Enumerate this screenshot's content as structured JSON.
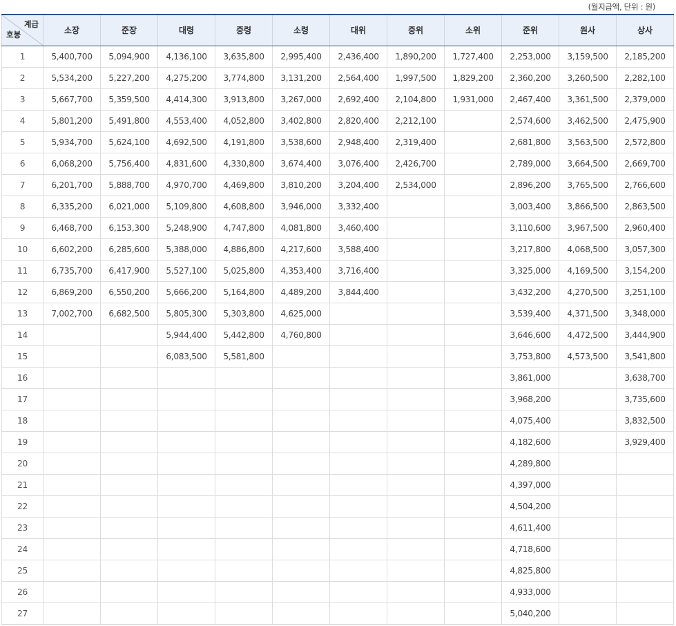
{
  "note": "(월지급액, 단위 : 원)",
  "corner": {
    "top": "계급",
    "bottom": "호봉"
  },
  "headers": [
    "소장",
    "준장",
    "대령",
    "중령",
    "소령",
    "대위",
    "중위",
    "소위",
    "준위",
    "원사",
    "상사"
  ],
  "rows": [
    [
      "1",
      "5,400,700",
      "5,094,900",
      "4,136,100",
      "3,635,800",
      "2,995,400",
      "2,436,400",
      "1,890,200",
      "1,727,400",
      "2,253,000",
      "3,159,500",
      "2,185,200"
    ],
    [
      "2",
      "5,534,200",
      "5,227,200",
      "4,275,200",
      "3,774,800",
      "3,131,200",
      "2,564,400",
      "1,997,500",
      "1,829,200",
      "2,360,200",
      "3,260,500",
      "2,282,100"
    ],
    [
      "3",
      "5,667,700",
      "5,359,500",
      "4,414,300",
      "3,913,800",
      "3,267,000",
      "2,692,400",
      "2,104,800",
      "1,931,000",
      "2,467,400",
      "3,361,500",
      "2,379,000"
    ],
    [
      "4",
      "5,801,200",
      "5,491,800",
      "4,553,400",
      "4,052,800",
      "3,402,800",
      "2,820,400",
      "2,212,100",
      "",
      "2,574,600",
      "3,462,500",
      "2,475,900"
    ],
    [
      "5",
      "5,934,700",
      "5,624,100",
      "4,692,500",
      "4,191,800",
      "3,538,600",
      "2,948,400",
      "2,319,400",
      "",
      "2,681,800",
      "3,563,500",
      "2,572,800"
    ],
    [
      "6",
      "6,068,200",
      "5,756,400",
      "4,831,600",
      "4,330,800",
      "3,674,400",
      "3,076,400",
      "2,426,700",
      "",
      "2,789,000",
      "3,664,500",
      "2,669,700"
    ],
    [
      "7",
      "6,201,700",
      "5,888,700",
      "4,970,700",
      "4,469,800",
      "3,810,200",
      "3,204,400",
      "2,534,000",
      "",
      "2,896,200",
      "3,765,500",
      "2,766,600"
    ],
    [
      "8",
      "6,335,200",
      "6,021,000",
      "5,109,800",
      "4,608,800",
      "3,946,000",
      "3,332,400",
      "",
      "",
      "3,003,400",
      "3,866,500",
      "2,863,500"
    ],
    [
      "9",
      "6,468,700",
      "6,153,300",
      "5,248,900",
      "4,747,800",
      "4,081,800",
      "3,460,400",
      "",
      "",
      "3,110,600",
      "3,967,500",
      "2,960,400"
    ],
    [
      "10",
      "6,602,200",
      "6,285,600",
      "5,388,000",
      "4,886,800",
      "4,217,600",
      "3,588,400",
      "",
      "",
      "3,217,800",
      "4,068,500",
      "3,057,300"
    ],
    [
      "11",
      "6,735,700",
      "6,417,900",
      "5,527,100",
      "5,025,800",
      "4,353,400",
      "3,716,400",
      "",
      "",
      "3,325,000",
      "4,169,500",
      "3,154,200"
    ],
    [
      "12",
      "6,869,200",
      "6,550,200",
      "5,666,200",
      "5,164,800",
      "4,489,200",
      "3,844,400",
      "",
      "",
      "3,432,200",
      "4,270,500",
      "3,251,100"
    ],
    [
      "13",
      "7,002,700",
      "6,682,500",
      "5,805,300",
      "5,303,800",
      "4,625,000",
      "",
      "",
      "",
      "3,539,400",
      "4,371,500",
      "3,348,000"
    ],
    [
      "14",
      "",
      "",
      "5,944,400",
      "5,442,800",
      "4,760,800",
      "",
      "",
      "",
      "3,646,600",
      "4,472,500",
      "3,444,900"
    ],
    [
      "15",
      "",
      "",
      "6,083,500",
      "5,581,800",
      "",
      "",
      "",
      "",
      "3,753,800",
      "4,573,500",
      "3,541,800"
    ],
    [
      "16",
      "",
      "",
      "",
      "",
      "",
      "",
      "",
      "",
      "3,861,000",
      "",
      "3,638,700"
    ],
    [
      "17",
      "",
      "",
      "",
      "",
      "",
      "",
      "",
      "",
      "3,968,200",
      "",
      "3,735,600"
    ],
    [
      "18",
      "",
      "",
      "",
      "",
      "",
      "",
      "",
      "",
      "4,075,400",
      "",
      "3,832,500"
    ],
    [
      "19",
      "",
      "",
      "",
      "",
      "",
      "",
      "",
      "",
      "4,182,600",
      "",
      "3,929,400"
    ],
    [
      "20",
      "",
      "",
      "",
      "",
      "",
      "",
      "",
      "",
      "4,289,800",
      "",
      ""
    ],
    [
      "21",
      "",
      "",
      "",
      "",
      "",
      "",
      "",
      "",
      "4,397,000",
      "",
      ""
    ],
    [
      "22",
      "",
      "",
      "",
      "",
      "",
      "",
      "",
      "",
      "4,504,200",
      "",
      ""
    ],
    [
      "23",
      "",
      "",
      "",
      "",
      "",
      "",
      "",
      "",
      "4,611,400",
      "",
      ""
    ],
    [
      "24",
      "",
      "",
      "",
      "",
      "",
      "",
      "",
      "",
      "4,718,600",
      "",
      ""
    ],
    [
      "25",
      "",
      "",
      "",
      "",
      "",
      "",
      "",
      "",
      "4,825,800",
      "",
      ""
    ],
    [
      "26",
      "",
      "",
      "",
      "",
      "",
      "",
      "",
      "",
      "4,933,000",
      "",
      ""
    ],
    [
      "27",
      "",
      "",
      "",
      "",
      "",
      "",
      "",
      "",
      "5,040,200",
      "",
      ""
    ]
  ]
}
